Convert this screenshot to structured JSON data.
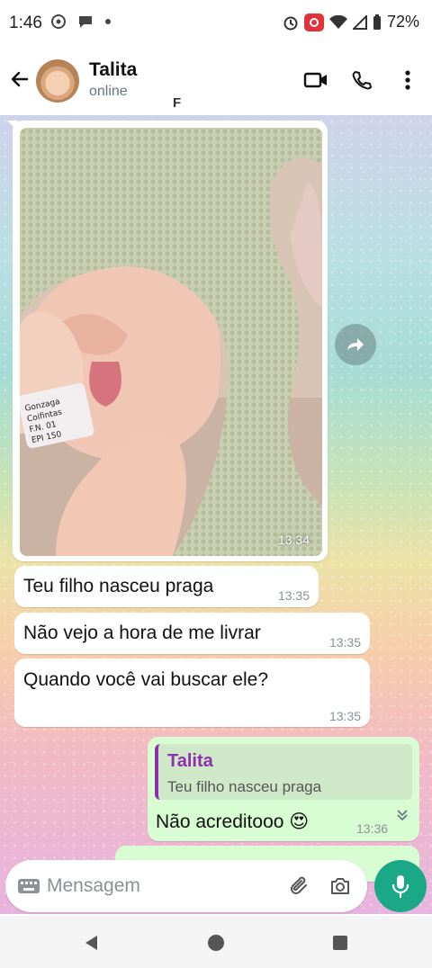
{
  "status_bar": {
    "time": "1:46",
    "battery": "72%"
  },
  "header": {
    "contact_name": "Talita",
    "contact_status": "online",
    "typing_glyph": "F"
  },
  "messages": [
    {
      "type": "image",
      "time": "13:34",
      "wristband_text": "Gonzaga Coifintas F.N. 01 EPI 150"
    },
    {
      "type": "text",
      "text": "Teu filho nasceu praga",
      "time": "13:35"
    },
    {
      "type": "text",
      "text": "Não vejo a hora de me livrar",
      "time": "13:35"
    },
    {
      "type": "text",
      "text": "Quando você vai buscar ele?",
      "time": "13:35"
    },
    {
      "type": "reply",
      "quote_author": "Talita",
      "quote_text": "Teu filho nasceu praga",
      "text": "Não acreditooo 😍",
      "time": "13:36"
    }
  ],
  "input": {
    "placeholder": "Mensagem"
  },
  "colors": {
    "accent": "#1aa886",
    "outgoing_bubble": "#d9fdd3",
    "quote_author": "#8e2fb0"
  }
}
